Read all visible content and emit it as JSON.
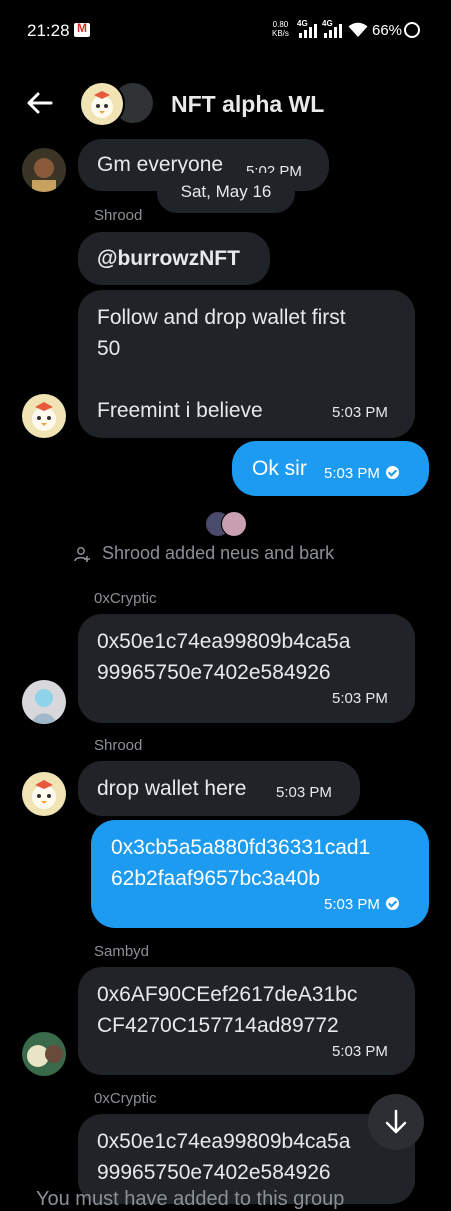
{
  "status_bar": {
    "time": "21:28",
    "net_speed_value": "0.80",
    "net_speed_unit": "KB/s",
    "sim1": "4G",
    "sim2": "4G",
    "battery": "66%"
  },
  "header": {
    "title": "NFT alpha WL"
  },
  "date_divider": "Sat, May 16",
  "messages": [
    {
      "sender": "",
      "text": "Gm everyone",
      "time": "5:02 PM",
      "mine": false
    },
    {
      "sender": "Shrood",
      "text": "@burrowzNFT",
      "time": "",
      "mine": false
    },
    {
      "sender": "",
      "text": "Follow and drop wallet first\n50\n\nFreemint i believe",
      "time": "5:03 PM",
      "mine": false
    },
    {
      "sender": "",
      "text": "Ok sir",
      "time": "5:03 PM",
      "mine": true
    },
    {
      "sender": "0xCryptic",
      "text": "0x50e1c74ea99809b4ca5a\n99965750e7402e584926",
      "time": "5:03 PM",
      "mine": false
    },
    {
      "sender": "Shrood",
      "text": "drop wallet here",
      "time": "5:03 PM",
      "mine": false
    },
    {
      "sender": "",
      "text": "0x3cb5a5a880fd36331cad1\n62b2faaf9657bc3a40b",
      "time": "5:03 PM",
      "mine": true
    },
    {
      "sender": "Sambyd",
      "text": "0x6AF90CEef2617deA31bc\nCF4270C157714ad89772",
      "time": "5:03 PM",
      "mine": false
    },
    {
      "sender": "0xCryptic",
      "text": "0x50e1c74ea99809b4ca5a\n99965750e7402e584926",
      "time": "",
      "mine": false
    }
  ],
  "system_message": "Shrood added neus and bark",
  "bottom_notice": "You must have added to this group",
  "colors": {
    "background": "#000000",
    "bubble_other": "#202327",
    "bubble_mine": "#1d9bf0",
    "muted_text": "#8b9096"
  },
  "icons": [
    "back-arrow-icon",
    "user-plus-icon",
    "arrow-down-icon",
    "check-icon",
    "gmail-icon",
    "wifi-icon",
    "signal-icon",
    "battery-icon"
  ]
}
